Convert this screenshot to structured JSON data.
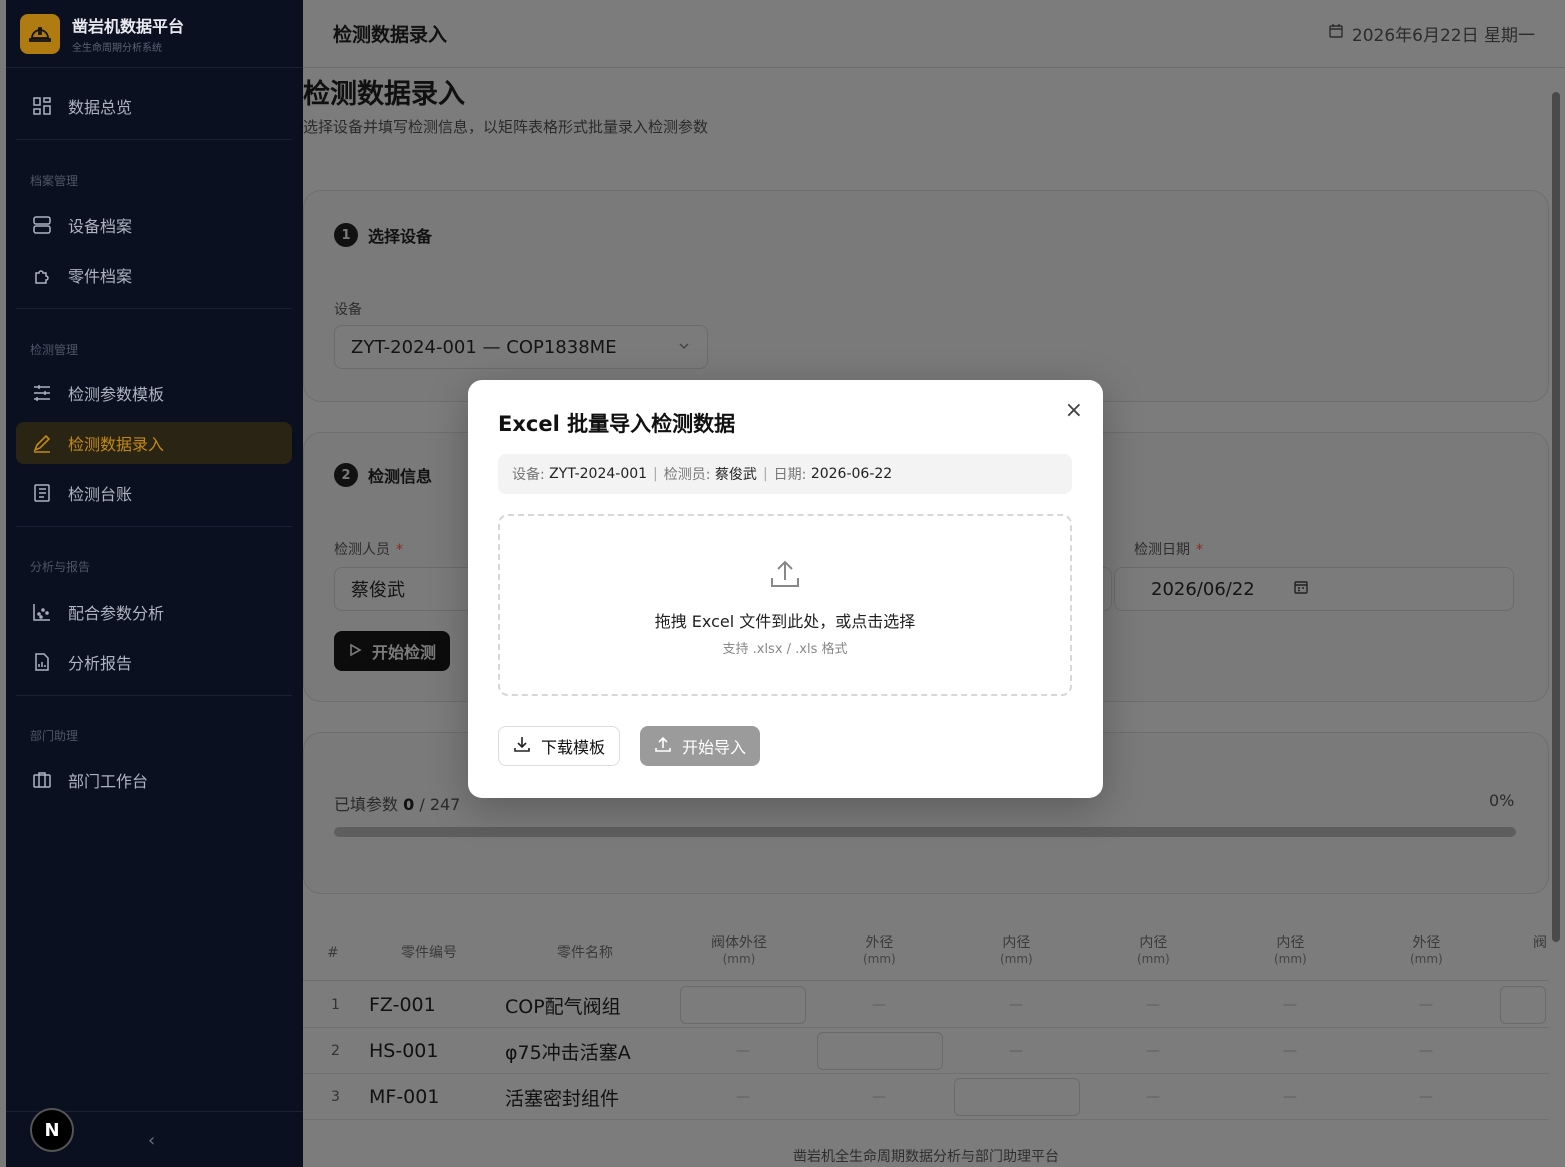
{
  "sidebar": {
    "brand_title": "凿岩机数据平台",
    "brand_sub": "全生命周期分析系统",
    "overview": "数据总览",
    "group_archive": "档案管理",
    "equipment_archive": "设备档案",
    "part_archive": "零件档案",
    "group_inspection": "检测管理",
    "param_template": "检测参数模板",
    "data_entry": "检测数据录入",
    "ledger": "检测台账",
    "group_analysis": "分析与报告",
    "fit_analysis": "配合参数分析",
    "analysis_report": "分析报告",
    "group_dept": "部门助理",
    "dept_workbench": "部门工作台",
    "avatar_letter": "N",
    "collapse_glyph": "‹"
  },
  "topbar": {
    "title": "检测数据录入",
    "date": "2026年6月22日 星期一"
  },
  "page": {
    "title": "检测数据录入",
    "subtitle": "选择设备并填写检测信息，以矩阵表格形式批量录入检测参数"
  },
  "step1": {
    "num": "1",
    "title": "选择设备",
    "device_label": "设备",
    "device_value": "ZYT-2024-001 — COP1838ME"
  },
  "step2": {
    "num": "2",
    "title": "检测信息",
    "inspector_label": "检测人员",
    "inspector_value": "蔡俊武",
    "date_label": "检测日期",
    "date_value": "2026/06/22",
    "start_button": "开始检测"
  },
  "progress": {
    "prefix": "已填参数",
    "filled": "0",
    "total": "/ 247",
    "percent": "0%",
    "fraction": 0
  },
  "table": {
    "headers": [
      {
        "label": "#",
        "unit": ""
      },
      {
        "label": "零件编号",
        "unit": ""
      },
      {
        "label": "零件名称",
        "unit": ""
      },
      {
        "label": "阀体外径",
        "unit": "(mm)"
      },
      {
        "label": "外径",
        "unit": "(mm)"
      },
      {
        "label": "内径",
        "unit": "(mm)"
      },
      {
        "label": "内径",
        "unit": "(mm)"
      },
      {
        "label": "内径",
        "unit": "(mm)"
      },
      {
        "label": "外径",
        "unit": "(mm)"
      },
      {
        "label": "阀",
        "unit": ""
      }
    ],
    "rows": [
      {
        "idx": "1",
        "code": "FZ-001",
        "name": "COP配气阀组"
      },
      {
        "idx": "2",
        "code": "HS-001",
        "name": "φ75冲击活塞A"
      },
      {
        "idx": "3",
        "code": "MF-001",
        "name": "活塞密封组件"
      }
    ],
    "dash": "—"
  },
  "footer": "凿岩机全生命周期数据分析与部门助理平台",
  "modal": {
    "title": "Excel 批量导入检测数据",
    "close": "×",
    "info_device_label": "设备:",
    "info_device": "ZYT-2024-001",
    "info_inspector_label": "检测员:",
    "info_inspector": "蔡俊武",
    "info_date_label": "日期:",
    "info_date": "2026-06-22",
    "sep": "|",
    "drop_text": "拖拽 Excel 文件到此处，或点击选择",
    "drop_sub": "支持 .xlsx / .xls 格式",
    "download_button": "下载模板",
    "import_button": "开始导入"
  },
  "colors": {
    "accent": "#c28a12",
    "sidebar_bg": "#0b1020"
  }
}
